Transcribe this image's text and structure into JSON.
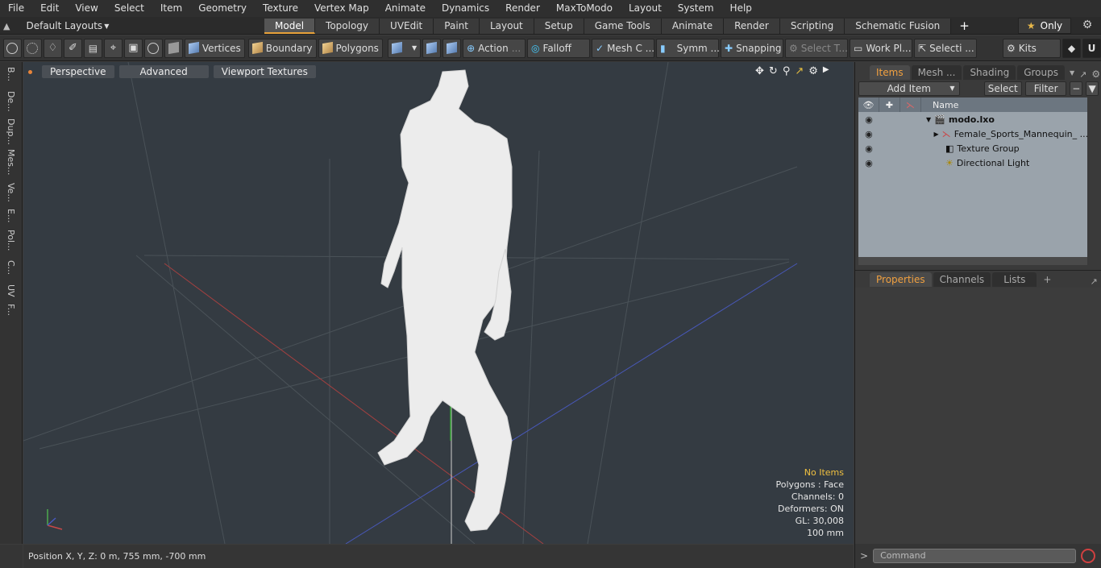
{
  "menu": [
    "File",
    "Edit",
    "View",
    "Select",
    "Item",
    "Geometry",
    "Texture",
    "Vertex Map",
    "Animate",
    "Dynamics",
    "Render",
    "MaxToModo",
    "Layout",
    "System",
    "Help"
  ],
  "layouts": {
    "label": "Default Layouts"
  },
  "tabs": [
    "Model",
    "Topology",
    "UVEdit",
    "Paint",
    "Layout",
    "Setup",
    "Game Tools",
    "Animate",
    "Render",
    "Scripting",
    "Schematic Fusion"
  ],
  "only_label": "Only",
  "toolbar": {
    "vertices": "Vertices",
    "boundary": "Boundary",
    "polygons": "Polygons",
    "action": "Action",
    "falloff": "Falloff",
    "mesh": "Mesh C ...",
    "symm": "Symm ...",
    "snapping": "Snapping",
    "select_t": "Select T...",
    "workplane": "Work Pl...",
    "selecti": "Selecti ...",
    "kits": "Kits"
  },
  "left_tabs": [
    "B...",
    "De...",
    "Dup...",
    "Mes...",
    "Ve...",
    "E...",
    "Pol...",
    "C...",
    "UV",
    "F..."
  ],
  "viewport": {
    "view": "Perspective",
    "advanced": "Advanced",
    "textures": "Viewport Textures",
    "info": {
      "items": "No Items",
      "polygons": "Polygons : Face",
      "channels": "Channels: 0",
      "deformers": "Deformers: ON",
      "gl": "GL: 30,008",
      "scale": "100 mm"
    }
  },
  "status": {
    "position": "Position X, Y, Z:   0 m, 755 mm, -700 mm"
  },
  "right": {
    "tabs": [
      "Items",
      "Mesh ...",
      "Shading",
      "Groups"
    ],
    "add_item": "Add Item",
    "select": "Select",
    "filter": "Filter",
    "name_col": "Name",
    "tree": [
      {
        "label": "modo.lxo"
      },
      {
        "label": "Female_Sports_Mannequin_ ..."
      },
      {
        "label": "Texture Group"
      },
      {
        "label": "Directional Light"
      }
    ],
    "prop_tabs": [
      "Properties",
      "Channels",
      "Lists"
    ],
    "command_placeholder": "Command"
  },
  "colors": {
    "accent": "#e8a23a",
    "viewport_bg": "#343b42",
    "tree_bg": "#9aa3ab"
  }
}
